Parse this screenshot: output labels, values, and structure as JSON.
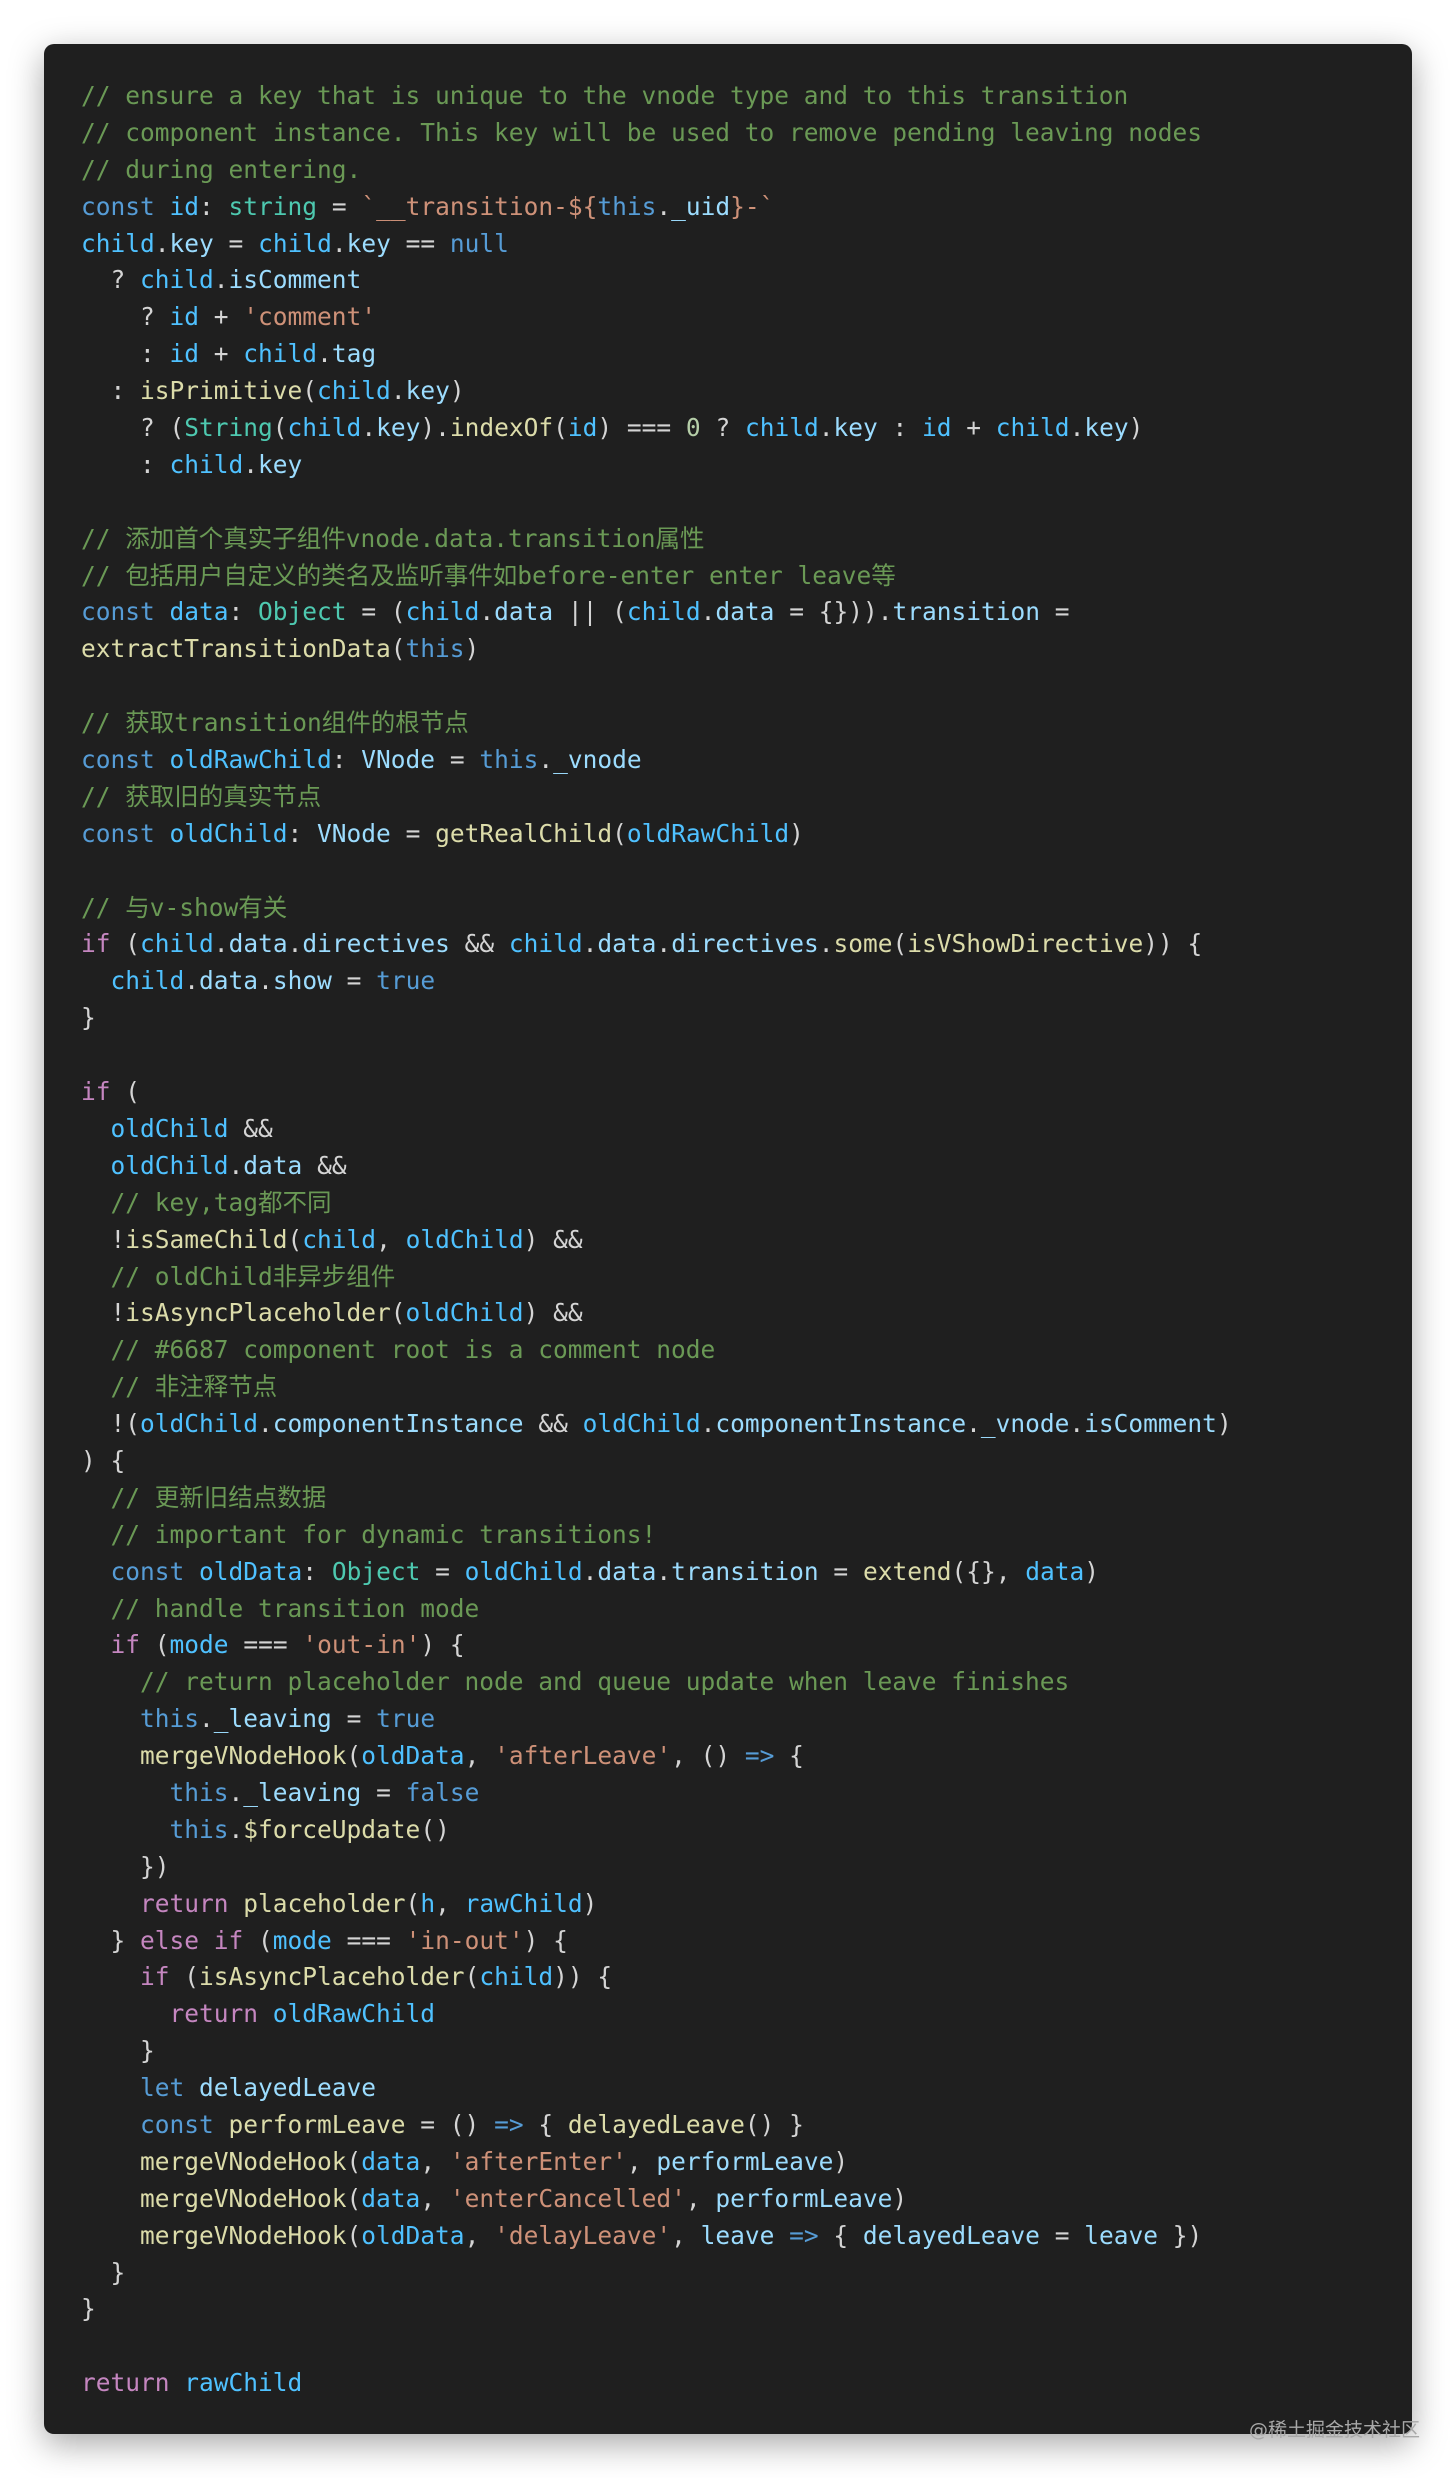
{
  "colors": {
    "background": "#1f1f1f",
    "comment": "#6a9955",
    "keyword": "#569cd6",
    "control": "#c586c0",
    "variable": "#4fc1ff",
    "property": "#9cdcfe",
    "function": "#dcdcaa",
    "type": "#4ec9b0",
    "string": "#ce9178",
    "number": "#b5cea8",
    "plain": "#d4d4d4"
  },
  "watermark": "@稀土掘金技术社区",
  "code_lines": [
    [
      [
        "comment",
        "// ensure a key that is unique to the vnode type and to this transition"
      ]
    ],
    [
      [
        "comment",
        "// component instance. This key will be used to remove pending leaving nodes"
      ]
    ],
    [
      [
        "comment",
        "// during entering."
      ]
    ],
    [
      [
        "keyword",
        "const "
      ],
      [
        "var",
        "id"
      ],
      [
        "plain",
        ": "
      ],
      [
        "type",
        "string"
      ],
      [
        "plain",
        " = "
      ],
      [
        "string",
        "`__transition-${"
      ],
      [
        "keyword",
        "this"
      ],
      [
        "plain",
        "."
      ],
      [
        "prop",
        "_uid"
      ],
      [
        "string",
        "}-`"
      ]
    ],
    [
      [
        "var",
        "child"
      ],
      [
        "plain",
        "."
      ],
      [
        "prop",
        "key"
      ],
      [
        "plain",
        " = "
      ],
      [
        "var",
        "child"
      ],
      [
        "plain",
        "."
      ],
      [
        "prop",
        "key"
      ],
      [
        "plain",
        " == "
      ],
      [
        "keyword",
        "null"
      ]
    ],
    [
      [
        "plain",
        "  ? "
      ],
      [
        "var",
        "child"
      ],
      [
        "plain",
        "."
      ],
      [
        "prop",
        "isComment"
      ]
    ],
    [
      [
        "plain",
        "    ? "
      ],
      [
        "var",
        "id"
      ],
      [
        "plain",
        " + "
      ],
      [
        "string",
        "'comment'"
      ]
    ],
    [
      [
        "plain",
        "    : "
      ],
      [
        "var",
        "id"
      ],
      [
        "plain",
        " + "
      ],
      [
        "var",
        "child"
      ],
      [
        "plain",
        "."
      ],
      [
        "prop",
        "tag"
      ]
    ],
    [
      [
        "plain",
        "  : "
      ],
      [
        "func",
        "isPrimitive"
      ],
      [
        "plain",
        "("
      ],
      [
        "var",
        "child"
      ],
      [
        "plain",
        "."
      ],
      [
        "prop",
        "key"
      ],
      [
        "plain",
        ")"
      ]
    ],
    [
      [
        "plain",
        "    ? ("
      ],
      [
        "type",
        "String"
      ],
      [
        "plain",
        "("
      ],
      [
        "var",
        "child"
      ],
      [
        "plain",
        "."
      ],
      [
        "prop",
        "key"
      ],
      [
        "plain",
        ")."
      ],
      [
        "func",
        "indexOf"
      ],
      [
        "plain",
        "("
      ],
      [
        "var",
        "id"
      ],
      [
        "plain",
        ") === "
      ],
      [
        "number",
        "0"
      ],
      [
        "plain",
        " ? "
      ],
      [
        "var",
        "child"
      ],
      [
        "plain",
        "."
      ],
      [
        "prop",
        "key"
      ],
      [
        "plain",
        " : "
      ],
      [
        "var",
        "id"
      ],
      [
        "plain",
        " + "
      ],
      [
        "var",
        "child"
      ],
      [
        "plain",
        "."
      ],
      [
        "prop",
        "key"
      ],
      [
        "plain",
        ")"
      ]
    ],
    [
      [
        "plain",
        "    : "
      ],
      [
        "var",
        "child"
      ],
      [
        "plain",
        "."
      ],
      [
        "prop",
        "key"
      ]
    ],
    [],
    [
      [
        "comment",
        "// 添加首个真实子组件vnode.data.transition属性"
      ]
    ],
    [
      [
        "comment",
        "// 包括用户自定义的类名及监听事件如before-enter enter leave等"
      ]
    ],
    [
      [
        "keyword",
        "const "
      ],
      [
        "var",
        "data"
      ],
      [
        "plain",
        ": "
      ],
      [
        "type",
        "Object"
      ],
      [
        "plain",
        " = ("
      ],
      [
        "var",
        "child"
      ],
      [
        "plain",
        "."
      ],
      [
        "prop",
        "data"
      ],
      [
        "plain",
        " || ("
      ],
      [
        "var",
        "child"
      ],
      [
        "plain",
        "."
      ],
      [
        "prop",
        "data"
      ],
      [
        "plain",
        " = {}))."
      ],
      [
        "prop",
        "transition"
      ],
      [
        "plain",
        " ="
      ]
    ],
    [
      [
        "func",
        "extractTransitionData"
      ],
      [
        "plain",
        "("
      ],
      [
        "keyword",
        "this"
      ],
      [
        "plain",
        ")"
      ]
    ],
    [],
    [
      [
        "comment",
        "// 获取transition组件的根节点"
      ]
    ],
    [
      [
        "keyword",
        "const "
      ],
      [
        "var",
        "oldRawChild"
      ],
      [
        "plain",
        ": "
      ],
      [
        "prop",
        "VNode"
      ],
      [
        "plain",
        " = "
      ],
      [
        "keyword",
        "this"
      ],
      [
        "plain",
        "."
      ],
      [
        "prop",
        "_vnode"
      ]
    ],
    [
      [
        "comment",
        "// 获取旧的真实节点"
      ]
    ],
    [
      [
        "keyword",
        "const "
      ],
      [
        "var",
        "oldChild"
      ],
      [
        "plain",
        ": "
      ],
      [
        "prop",
        "VNode"
      ],
      [
        "plain",
        " = "
      ],
      [
        "func",
        "getRealChild"
      ],
      [
        "plain",
        "("
      ],
      [
        "var",
        "oldRawChild"
      ],
      [
        "plain",
        ")"
      ]
    ],
    [],
    [
      [
        "comment",
        "// 与v-show有关"
      ]
    ],
    [
      [
        "control",
        "if"
      ],
      [
        "plain",
        " ("
      ],
      [
        "var",
        "child"
      ],
      [
        "plain",
        "."
      ],
      [
        "prop",
        "data"
      ],
      [
        "plain",
        "."
      ],
      [
        "prop",
        "directives"
      ],
      [
        "plain",
        " && "
      ],
      [
        "var",
        "child"
      ],
      [
        "plain",
        "."
      ],
      [
        "prop",
        "data"
      ],
      [
        "plain",
        "."
      ],
      [
        "prop",
        "directives"
      ],
      [
        "plain",
        "."
      ],
      [
        "func",
        "some"
      ],
      [
        "plain",
        "("
      ],
      [
        "func",
        "isVShowDirective"
      ],
      [
        "plain",
        ")) {"
      ]
    ],
    [
      [
        "plain",
        "  "
      ],
      [
        "var",
        "child"
      ],
      [
        "plain",
        "."
      ],
      [
        "prop",
        "data"
      ],
      [
        "plain",
        "."
      ],
      [
        "prop",
        "show"
      ],
      [
        "plain",
        " = "
      ],
      [
        "keyword",
        "true"
      ]
    ],
    [
      [
        "plain",
        "}"
      ]
    ],
    [],
    [
      [
        "control",
        "if"
      ],
      [
        "plain",
        " ("
      ]
    ],
    [
      [
        "plain",
        "  "
      ],
      [
        "var",
        "oldChild"
      ],
      [
        "plain",
        " &&"
      ]
    ],
    [
      [
        "plain",
        "  "
      ],
      [
        "var",
        "oldChild"
      ],
      [
        "plain",
        "."
      ],
      [
        "prop",
        "data"
      ],
      [
        "plain",
        " &&"
      ]
    ],
    [
      [
        "plain",
        "  "
      ],
      [
        "comment",
        "// key,tag都不同"
      ]
    ],
    [
      [
        "plain",
        "  !"
      ],
      [
        "func",
        "isSameChild"
      ],
      [
        "plain",
        "("
      ],
      [
        "var",
        "child"
      ],
      [
        "plain",
        ", "
      ],
      [
        "var",
        "oldChild"
      ],
      [
        "plain",
        ") &&"
      ]
    ],
    [
      [
        "plain",
        "  "
      ],
      [
        "comment",
        "// oldChild非异步组件"
      ]
    ],
    [
      [
        "plain",
        "  !"
      ],
      [
        "func",
        "isAsyncPlaceholder"
      ],
      [
        "plain",
        "("
      ],
      [
        "var",
        "oldChild"
      ],
      [
        "plain",
        ") &&"
      ]
    ],
    [
      [
        "plain",
        "  "
      ],
      [
        "comment",
        "// #6687 component root is a comment node"
      ]
    ],
    [
      [
        "plain",
        "  "
      ],
      [
        "comment",
        "// 非注释节点"
      ]
    ],
    [
      [
        "plain",
        "  !("
      ],
      [
        "var",
        "oldChild"
      ],
      [
        "plain",
        "."
      ],
      [
        "prop",
        "componentInstance"
      ],
      [
        "plain",
        " && "
      ],
      [
        "var",
        "oldChild"
      ],
      [
        "plain",
        "."
      ],
      [
        "prop",
        "componentInstance"
      ],
      [
        "plain",
        "."
      ],
      [
        "prop",
        "_vnode"
      ],
      [
        "plain",
        "."
      ],
      [
        "prop",
        "isComment"
      ],
      [
        "plain",
        ")"
      ]
    ],
    [
      [
        "plain",
        ") {"
      ]
    ],
    [
      [
        "plain",
        "  "
      ],
      [
        "comment",
        "// 更新旧结点数据"
      ]
    ],
    [
      [
        "plain",
        "  "
      ],
      [
        "comment",
        "// important for dynamic transitions!"
      ]
    ],
    [
      [
        "plain",
        "  "
      ],
      [
        "keyword",
        "const "
      ],
      [
        "var",
        "oldData"
      ],
      [
        "plain",
        ": "
      ],
      [
        "type",
        "Object"
      ],
      [
        "plain",
        " = "
      ],
      [
        "var",
        "oldChild"
      ],
      [
        "plain",
        "."
      ],
      [
        "prop",
        "data"
      ],
      [
        "plain",
        "."
      ],
      [
        "prop",
        "transition"
      ],
      [
        "plain",
        " = "
      ],
      [
        "func",
        "extend"
      ],
      [
        "plain",
        "({}, "
      ],
      [
        "var",
        "data"
      ],
      [
        "plain",
        ")"
      ]
    ],
    [
      [
        "plain",
        "  "
      ],
      [
        "comment",
        "// handle transition mode"
      ]
    ],
    [
      [
        "plain",
        "  "
      ],
      [
        "control",
        "if"
      ],
      [
        "plain",
        " ("
      ],
      [
        "var",
        "mode"
      ],
      [
        "plain",
        " === "
      ],
      [
        "string",
        "'out-in'"
      ],
      [
        "plain",
        ") {"
      ]
    ],
    [
      [
        "plain",
        "    "
      ],
      [
        "comment",
        "// return placeholder node and queue update when leave finishes"
      ]
    ],
    [
      [
        "plain",
        "    "
      ],
      [
        "keyword",
        "this"
      ],
      [
        "plain",
        "."
      ],
      [
        "prop",
        "_leaving"
      ],
      [
        "plain",
        " = "
      ],
      [
        "keyword",
        "true"
      ]
    ],
    [
      [
        "plain",
        "    "
      ],
      [
        "func",
        "mergeVNodeHook"
      ],
      [
        "plain",
        "("
      ],
      [
        "var",
        "oldData"
      ],
      [
        "plain",
        ", "
      ],
      [
        "string",
        "'afterLeave'"
      ],
      [
        "plain",
        ", () "
      ],
      [
        "keyword",
        "=>"
      ],
      [
        "plain",
        " {"
      ]
    ],
    [
      [
        "plain",
        "      "
      ],
      [
        "keyword",
        "this"
      ],
      [
        "plain",
        "."
      ],
      [
        "prop",
        "_leaving"
      ],
      [
        "plain",
        " = "
      ],
      [
        "keyword",
        "false"
      ]
    ],
    [
      [
        "plain",
        "      "
      ],
      [
        "keyword",
        "this"
      ],
      [
        "plain",
        "."
      ],
      [
        "func",
        "$forceUpdate"
      ],
      [
        "plain",
        "()"
      ]
    ],
    [
      [
        "plain",
        "    })"
      ]
    ],
    [
      [
        "plain",
        "    "
      ],
      [
        "control",
        "return "
      ],
      [
        "func",
        "placeholder"
      ],
      [
        "plain",
        "("
      ],
      [
        "var",
        "h"
      ],
      [
        "plain",
        ", "
      ],
      [
        "var",
        "rawChild"
      ],
      [
        "plain",
        ")"
      ]
    ],
    [
      [
        "plain",
        "  } "
      ],
      [
        "control",
        "else if"
      ],
      [
        "plain",
        " ("
      ],
      [
        "var",
        "mode"
      ],
      [
        "plain",
        " === "
      ],
      [
        "string",
        "'in-out'"
      ],
      [
        "plain",
        ") {"
      ]
    ],
    [
      [
        "plain",
        "    "
      ],
      [
        "control",
        "if"
      ],
      [
        "plain",
        " ("
      ],
      [
        "func",
        "isAsyncPlaceholder"
      ],
      [
        "plain",
        "("
      ],
      [
        "var",
        "child"
      ],
      [
        "plain",
        ")) {"
      ]
    ],
    [
      [
        "plain",
        "      "
      ],
      [
        "control",
        "return "
      ],
      [
        "var",
        "oldRawChild"
      ]
    ],
    [
      [
        "plain",
        "    }"
      ]
    ],
    [
      [
        "plain",
        "    "
      ],
      [
        "keyword",
        "let "
      ],
      [
        "prop",
        "delayedLeave"
      ]
    ],
    [
      [
        "plain",
        "    "
      ],
      [
        "keyword",
        "const "
      ],
      [
        "func",
        "performLeave"
      ],
      [
        "plain",
        " = () "
      ],
      [
        "keyword",
        "=>"
      ],
      [
        "plain",
        " { "
      ],
      [
        "func",
        "delayedLeave"
      ],
      [
        "plain",
        "() }"
      ]
    ],
    [
      [
        "plain",
        "    "
      ],
      [
        "func",
        "mergeVNodeHook"
      ],
      [
        "plain",
        "("
      ],
      [
        "var",
        "data"
      ],
      [
        "plain",
        ", "
      ],
      [
        "string",
        "'afterEnter'"
      ],
      [
        "plain",
        ", "
      ],
      [
        "prop",
        "performLeave"
      ],
      [
        "plain",
        ")"
      ]
    ],
    [
      [
        "plain",
        "    "
      ],
      [
        "func",
        "mergeVNodeHook"
      ],
      [
        "plain",
        "("
      ],
      [
        "var",
        "data"
      ],
      [
        "plain",
        ", "
      ],
      [
        "string",
        "'enterCancelled'"
      ],
      [
        "plain",
        ", "
      ],
      [
        "prop",
        "performLeave"
      ],
      [
        "plain",
        ")"
      ]
    ],
    [
      [
        "plain",
        "    "
      ],
      [
        "func",
        "mergeVNodeHook"
      ],
      [
        "plain",
        "("
      ],
      [
        "var",
        "oldData"
      ],
      [
        "plain",
        ", "
      ],
      [
        "string",
        "'delayLeave'"
      ],
      [
        "plain",
        ", "
      ],
      [
        "prop",
        "leave"
      ],
      [
        "plain",
        " "
      ],
      [
        "keyword",
        "=>"
      ],
      [
        "plain",
        " { "
      ],
      [
        "prop",
        "delayedLeave"
      ],
      [
        "plain",
        " = "
      ],
      [
        "prop",
        "leave"
      ],
      [
        "plain",
        " })"
      ]
    ],
    [
      [
        "plain",
        "  }"
      ]
    ],
    [
      [
        "plain",
        "}"
      ]
    ],
    [],
    [
      [
        "control",
        "return "
      ],
      [
        "var",
        "rawChild"
      ]
    ]
  ]
}
